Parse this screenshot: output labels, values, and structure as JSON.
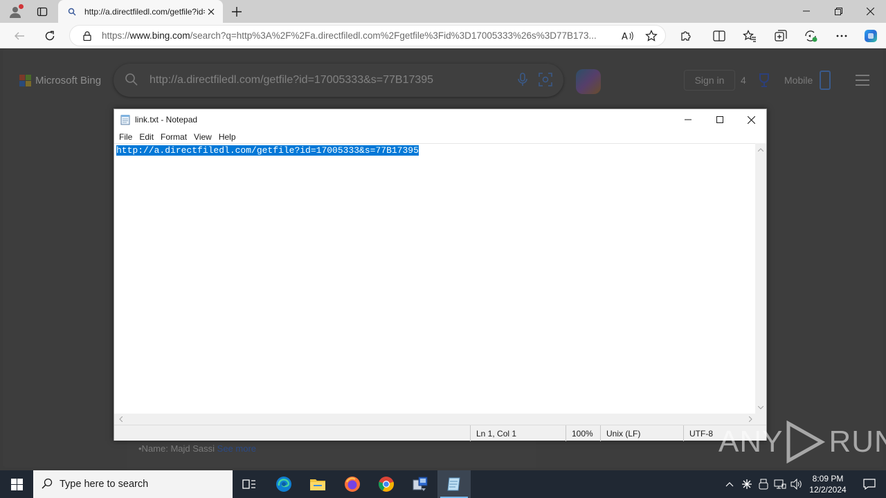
{
  "browser": {
    "tab_title": "http://a.directfiledl.com/getfile?id=",
    "url_prefix": "https://",
    "url_host": "www.bing.com",
    "url_path": "/search?q=http%3A%2F%2Fa.directfiledl.com%2Fgetfile%3Fid%3D17005333%26s%3D77B173..."
  },
  "bing": {
    "logo_text": "Microsoft Bing",
    "query": "http://a.directfiledl.com/getfile?id=17005333&s=77B17395",
    "signin": "Sign in",
    "rewards_count": "4",
    "mobile": "Mobile",
    "result_prefix": "•Name: Majd Sassi ",
    "result_link": "See more"
  },
  "notepad": {
    "title": "link.txt - Notepad",
    "menu": [
      "File",
      "Edit",
      "Format",
      "View",
      "Help"
    ],
    "content": "http://a.directfiledl.com/getfile?id=17005333&s=77B17395",
    "status": {
      "position": "Ln 1, Col 1",
      "zoom": "100%",
      "line_ending": "Unix (LF)",
      "encoding": "UTF-8"
    }
  },
  "watermark": {
    "left": "ANY",
    "right": "RUN"
  },
  "taskbar": {
    "search_placeholder": "Type here to search",
    "time": "8:09 PM",
    "date": "12/2/2024"
  },
  "colors": {
    "selection": "#0078d7",
    "taskbar": "#202833",
    "page_dim": "#3d3d3d"
  }
}
